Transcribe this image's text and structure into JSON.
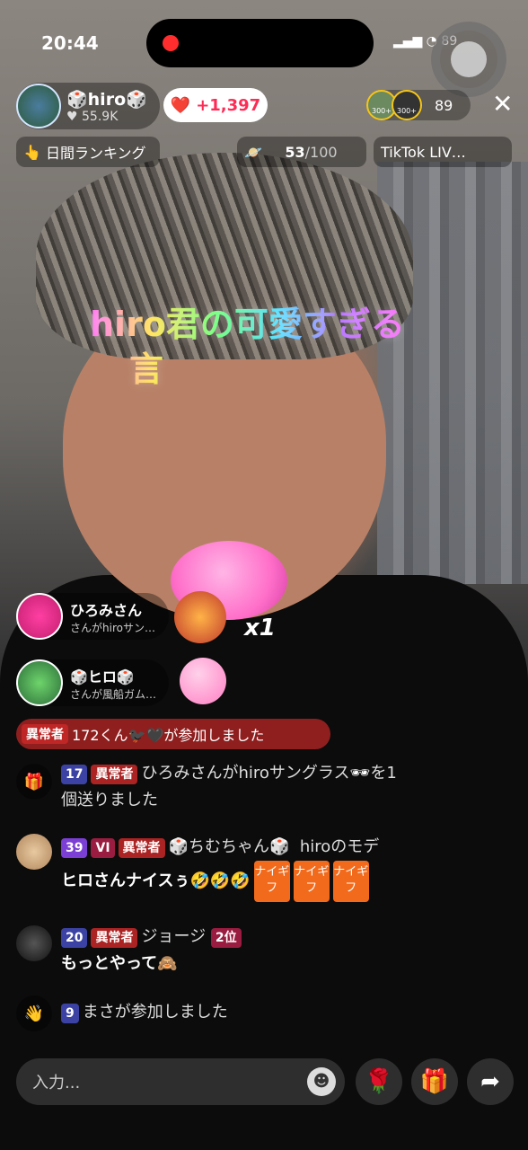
{
  "status_bar": {
    "time": "20:44",
    "battery": "89"
  },
  "host": {
    "name": "🎲hiro🎲",
    "likes": "55.9K"
  },
  "like_pill": {
    "value": "+1,397"
  },
  "viewers": {
    "badge_1": "300+",
    "badge_2": "300+",
    "count": "89"
  },
  "pills": {
    "daily_ranking": "日間ランキング",
    "progress": "53",
    "progress_total": "/100",
    "tiktok_live": "TikTok LIV…"
  },
  "caption": {
    "line1": "hiro君の可愛すぎる",
    "line2": "言"
  },
  "gifts": [
    {
      "name": "ひろみさん",
      "sub": "さんがhiroサン…",
      "count": "x1"
    },
    {
      "name": "🎲ヒロ🎲",
      "sub": "さんが風船ガム…"
    }
  ],
  "join_banner": {
    "badge": "異常者",
    "text": "172くん🐦‍⬛🖤が参加しました"
  },
  "messages": [
    {
      "level": "17",
      "tag": "異常者",
      "text1": "ひろみさんがhiroサングラス",
      "text2": "を1",
      "text3": "個送りました"
    },
    {
      "level": "39",
      "level_tag": "VI",
      "tag": "異常者",
      "name": "🎲ちむちゃん🎲",
      "mod": "hiroのモデ",
      "text": "ヒロさんナイスぅ🤣🤣🤣",
      "chips": [
        "ナイギフ",
        "ナイギフ",
        "ナイギフ"
      ]
    },
    {
      "level": "20",
      "tag": "異常者",
      "name": "ジョージ",
      "rank": "2位",
      "text": "もっとやって🙈"
    },
    {
      "level": "9",
      "text": "まさが参加しました"
    }
  ],
  "input": {
    "placeholder": "入力..."
  },
  "icons": [
    "mute-icon",
    "heart-icon",
    "close-icon",
    "fire-icon",
    "planet-icon",
    "gift-box-icon",
    "rose-icon",
    "gift-icon",
    "share-icon",
    "wave-icon",
    "smile-icon"
  ],
  "colors": {
    "accent": "#fe2c55",
    "chip": "#f26a1b",
    "badge_red": "#c82828"
  }
}
